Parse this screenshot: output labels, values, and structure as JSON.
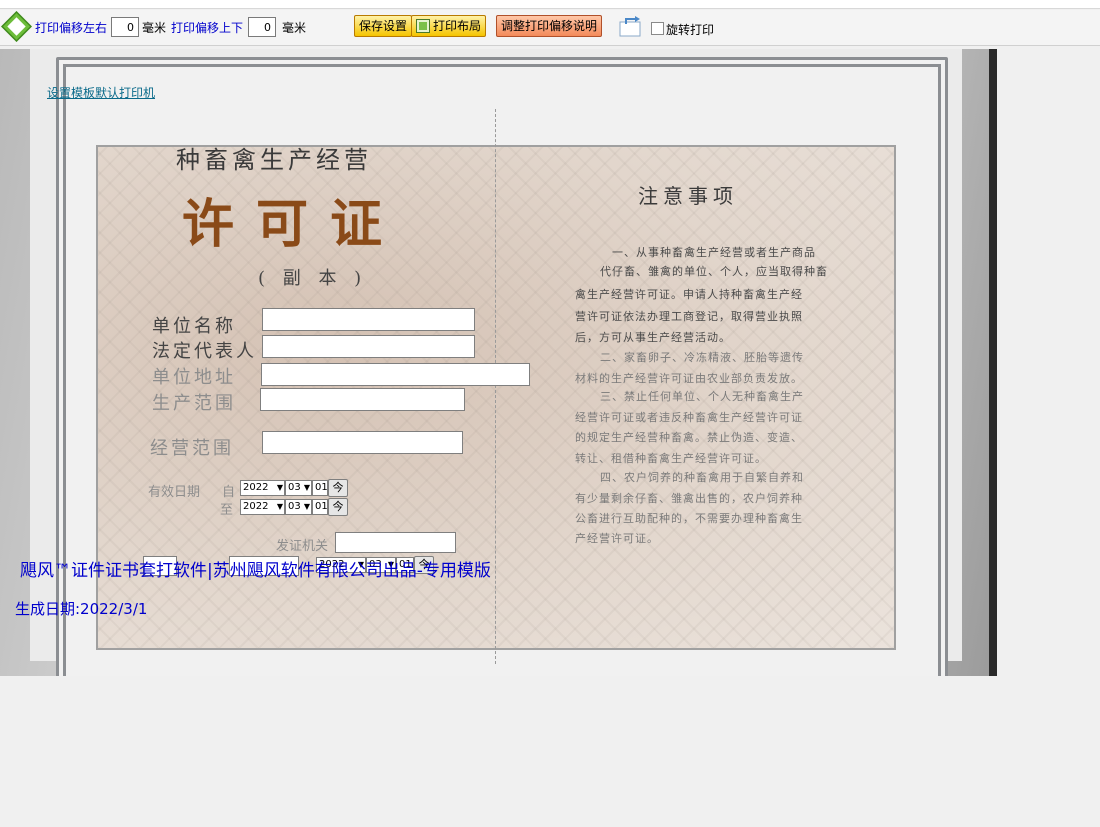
{
  "toolbar": {
    "offset_lr_label": "打印偏移左右",
    "offset_lr_value": "0",
    "offset_lr_unit": "毫米",
    "offset_ud_label": "打印偏移上下",
    "offset_ud_value": "0",
    "offset_ud_unit": "毫米",
    "save_label": "保存设置",
    "layout_label": "打印布局",
    "help_label": "调整打印偏移说明",
    "rotate_label": "旋转打印",
    "rotate_checked": false
  },
  "printer_link": "设置模板默认打印机",
  "certificate": {
    "title_small": "种畜禽生产经营",
    "title_big": "许可证",
    "copy_mark": "( 副 本 )",
    "labels": {
      "unit_name": "单位名称",
      "legal_rep": "法定代表人",
      "address": "单位地址",
      "production_scope": "生产范围",
      "business_scope": "经营范围",
      "valid_period": "有效日期",
      "from": "自",
      "to": "至",
      "issuer": "发证机关"
    },
    "notes_title": "注意事项",
    "notes_lines": [
      "一、从事种畜禽生产经营或者生产商品",
      "代仔畜、雏禽的单位、个人，应当取得种畜",
      "禽生产经营许可证。申请人持种畜禽生产经",
      "营许可证依法办理工商登记，取得营业执照",
      "后，方可从事生产经营活动。",
      "二、家畜卵子、冷冻精液、胚胎等遗传",
      "材料的生产经营许可证由农业部负责发放。",
      "三、禁止任何单位、个人无种畜禽生产",
      "经营许可证或者违反种畜禽生产经营许可证",
      "的规定生产经营种畜禽。禁止伪造、变造、",
      "转让、租借种畜禽生产经营许可证。",
      "四、农户饲养的种畜禽用于自繁自养和",
      "有少量剩余仔畜、雏禽出售的，农户饲养种",
      "公畜进行互助配种的，不需要办理种畜禽生",
      "产经营许可证。"
    ]
  },
  "dates": {
    "start": {
      "year": "2022",
      "month": "03",
      "day": "01",
      "today": "今"
    },
    "end": {
      "year": "2022",
      "month": "03",
      "day": "01",
      "today": "今"
    },
    "issue": {
      "year": "2022",
      "month": "03",
      "day": "01",
      "today": "今"
    }
  },
  "footer_text": "飓风™证件证书套打软件|苏州飓风软件有限公司出品-专用模版",
  "generated_date": "生成日期:2022/3/1"
}
